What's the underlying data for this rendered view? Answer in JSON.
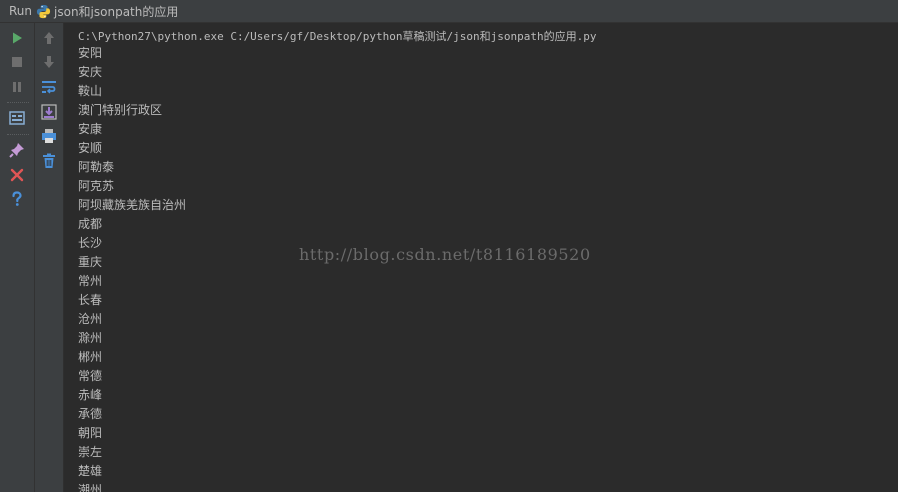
{
  "titlebar": {
    "run_label": "Run",
    "config_name": "json和jsonpath的应用",
    "config_icon": "python-icon"
  },
  "toolbar_left": [
    {
      "name": "rerun-icon",
      "color": "#59a869"
    },
    {
      "name": "stop-icon",
      "color": "#6e6e6e"
    },
    {
      "name": "pause-icon",
      "color": "#6e6e6e"
    },
    {
      "name": "dump-threads-icon",
      "color": "#88aed4"
    },
    {
      "name": "pin-tab-icon",
      "color": "#c59bd6"
    },
    {
      "name": "close-icon",
      "color": "#e05555"
    },
    {
      "name": "help-icon",
      "color": "#4a90d9"
    }
  ],
  "toolbar_right": [
    {
      "name": "up-arrow-icon",
      "color": "#6e6e6e"
    },
    {
      "name": "down-arrow-icon",
      "color": "#6e6e6e"
    },
    {
      "name": "soft-wrap-icon",
      "color": "#4a90d9"
    },
    {
      "name": "scroll-to-end-icon",
      "color": "#9e7ccf"
    },
    {
      "name": "print-icon",
      "color": "#4a90d9"
    },
    {
      "name": "clear-all-icon",
      "color": "#4a90d9"
    }
  ],
  "console": {
    "command": "C:\\Python27\\python.exe C:/Users/gf/Desktop/python草稿测试/json和jsonpath的应用.py",
    "lines": [
      "安阳",
      "安庆",
      "鞍山",
      "澳门特别行政区",
      "安康",
      "安顺",
      "阿勒泰",
      "阿克苏",
      "阿坝藏族羌族自治州",
      "成都",
      "长沙",
      "重庆",
      "常州",
      "长春",
      "沧州",
      "滁州",
      "郴州",
      "常德",
      "赤峰",
      "承德",
      "朝阳",
      "崇左",
      "楚雄",
      "潮州"
    ]
  },
  "watermark": "http://blog.csdn.net/t8116189520"
}
